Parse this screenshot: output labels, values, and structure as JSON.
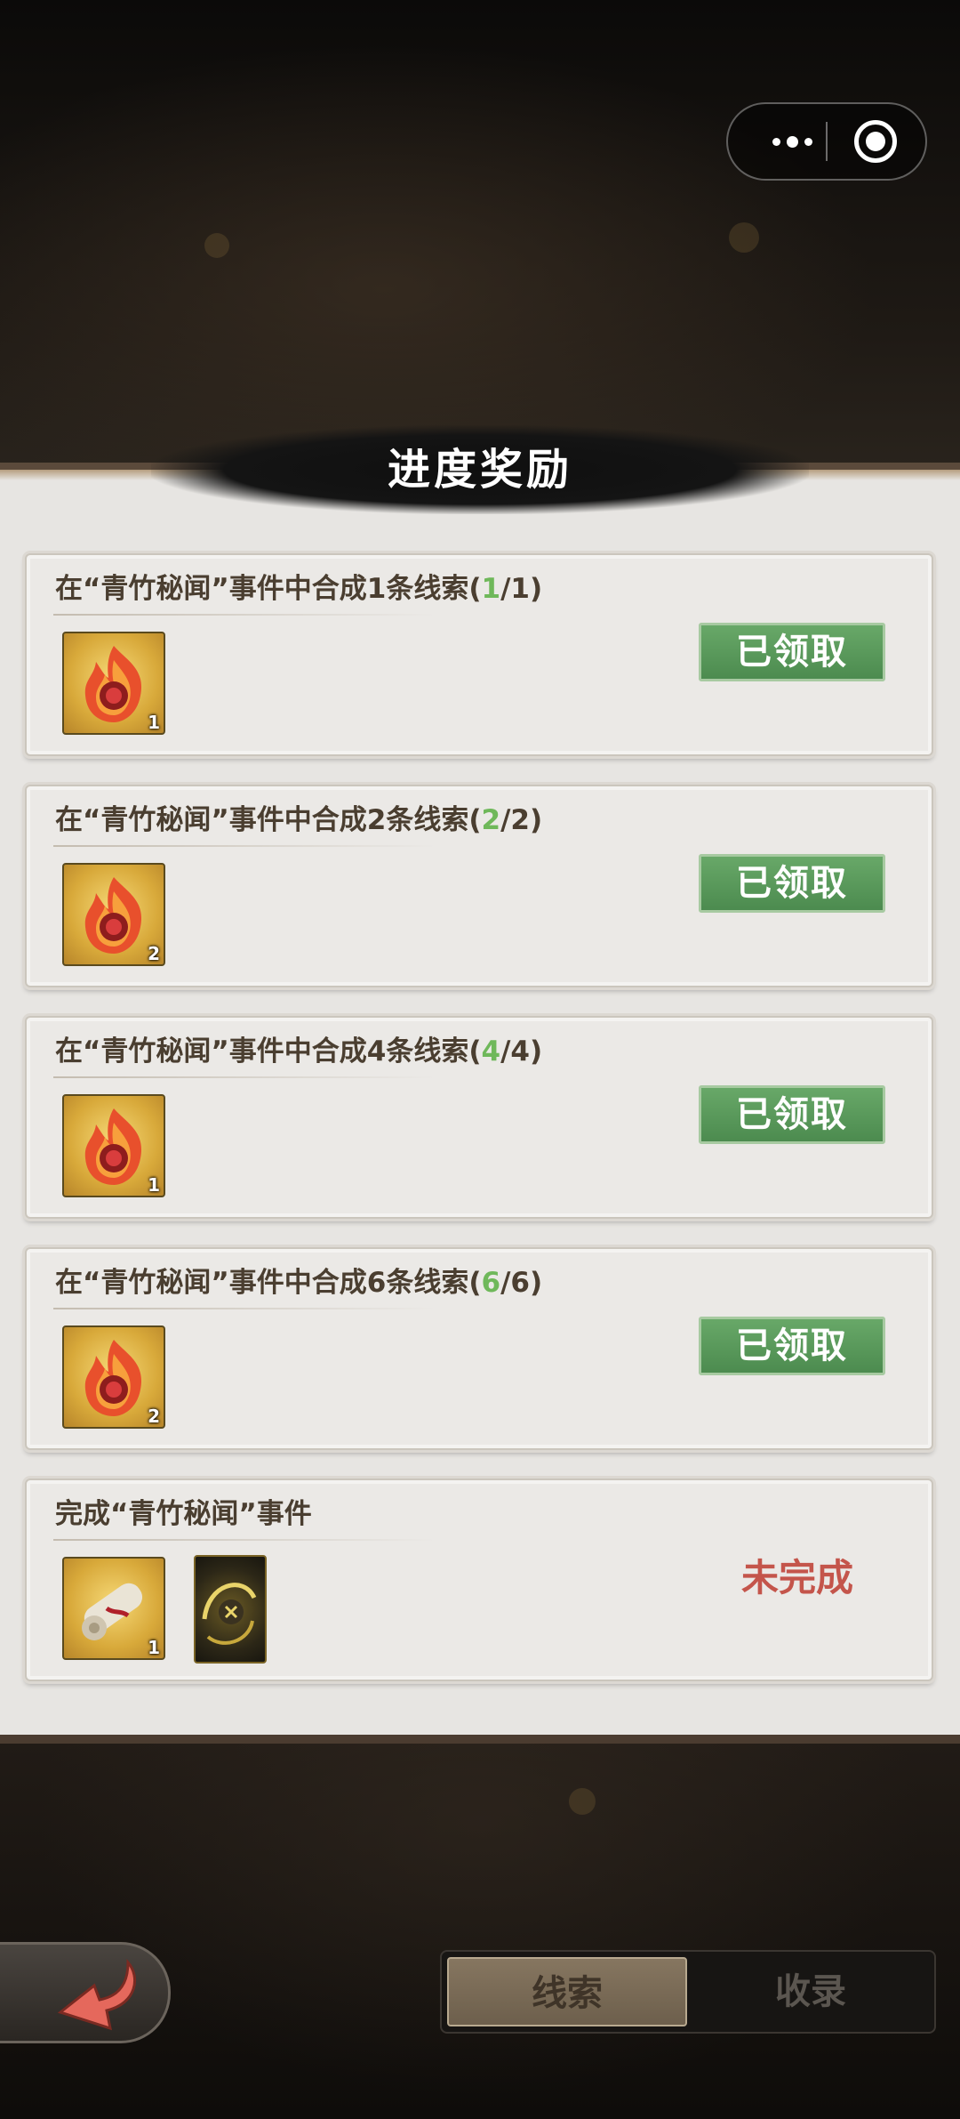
{
  "header": {
    "title": "进度奖励"
  },
  "capsule": {
    "more_icon": "more-dots-icon",
    "close_icon": "target-circle-icon"
  },
  "tasks": [
    {
      "title_prefix": "在“青竹秘闻”事件中合成1条线索(",
      "progress_done": "1",
      "progress_rest": "/1)",
      "rewards": [
        {
          "icon": "flame-orb-icon",
          "count": "1"
        }
      ],
      "status": "已领取"
    },
    {
      "title_prefix": "在“青竹秘闻”事件中合成2条线索(",
      "progress_done": "2",
      "progress_rest": "/2)",
      "rewards": [
        {
          "icon": "flame-orb-icon",
          "count": "2"
        }
      ],
      "status": "已领取"
    },
    {
      "title_prefix": "在“青竹秘闻”事件中合成4条线索(",
      "progress_done": "4",
      "progress_rest": "/4)",
      "rewards": [
        {
          "icon": "flame-orb-icon",
          "count": "1"
        }
      ],
      "status": "已领取"
    },
    {
      "title_prefix": "在“青竹秘闻”事件中合成6条线索(",
      "progress_done": "6",
      "progress_rest": "/6)",
      "rewards": [
        {
          "icon": "flame-orb-icon",
          "count": "2"
        }
      ],
      "status": "已领取"
    },
    {
      "title_prefix": "完成“青竹秘闻”事件",
      "progress_done": "",
      "progress_rest": "",
      "rewards": [
        {
          "icon": "scroll-icon",
          "count": "1"
        },
        {
          "icon": "golden-swirl-icon",
          "count": ""
        }
      ],
      "status": "未完成"
    }
  ],
  "bottom": {
    "back_icon": "back-arrow-icon",
    "tabs": [
      {
        "label": "线索",
        "active": true
      },
      {
        "label": "收录",
        "active": false
      }
    ]
  },
  "colors": {
    "claimed_button": "#4c8b4f",
    "incomplete_text": "#c4554b",
    "progress_done": "#6fb85a"
  }
}
